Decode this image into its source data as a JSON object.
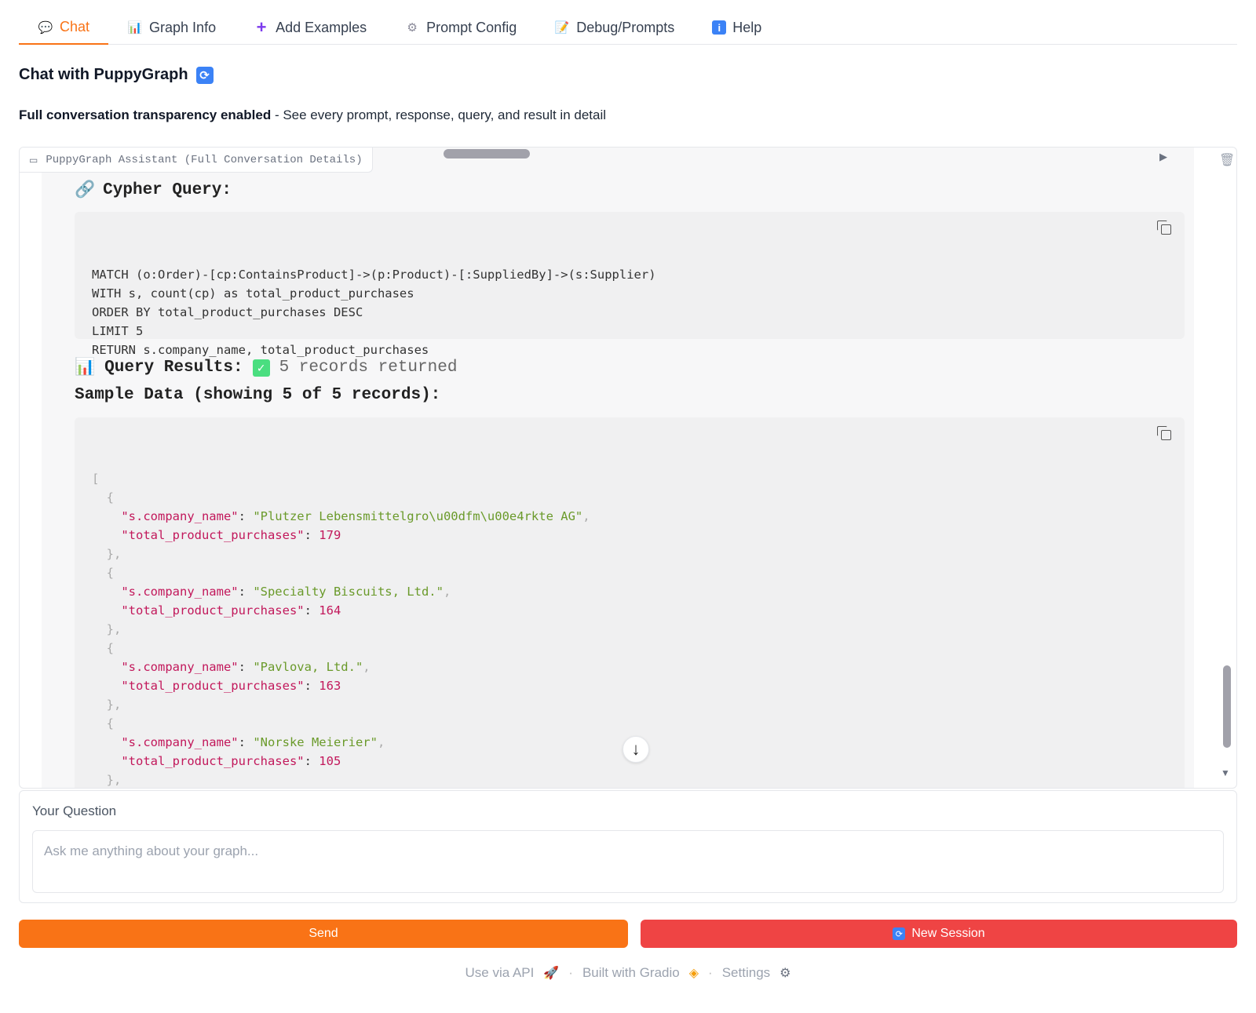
{
  "tabs": [
    {
      "label": "Chat",
      "icon": "speech-bubble-icon"
    },
    {
      "label": "Graph Info",
      "icon": "bar-chart-icon"
    },
    {
      "label": "Add Examples",
      "icon": "plus-icon"
    },
    {
      "label": "Prompt Config",
      "icon": "gear-icon"
    },
    {
      "label": "Debug/Prompts",
      "icon": "memo-icon"
    },
    {
      "label": "Help",
      "icon": "info-icon"
    }
  ],
  "header": {
    "title": "Chat with PuppyGraph",
    "subtitle_bold": "Full conversation transparency enabled",
    "subtitle_rest": " - See every prompt, response, query, and result in detail"
  },
  "chat": {
    "label": "PuppyGraph Assistant (Full Conversation Details)",
    "cypher_heading": "Cypher Query:",
    "cypher_lines": [
      "MATCH (o:Order)-[cp:ContainsProduct]->(p:Product)-[:SuppliedBy]->(s:Supplier)",
      "WITH s, count(cp) as total_product_purchases",
      "ORDER BY total_product_purchases DESC",
      "LIMIT 5",
      "RETURN s.company_name, total_product_purchases"
    ],
    "results_heading": "Query Results:",
    "records_text": "5 records returned",
    "sample_heading": "Sample Data (showing 5 of 5 records):",
    "json_key_name": "\"s.company_name\"",
    "json_key_total": "\"total_product_purchases\"",
    "records": [
      {
        "company": "\"Plutzer Lebensmittelgro\\u00dfm\\u00e4rkte AG\"",
        "total": "179"
      },
      {
        "company": "\"Specialty Biscuits, Ltd.\"",
        "total": "164"
      },
      {
        "company": "\"Pavlova, Ltd.\"",
        "total": "163"
      },
      {
        "company": "\"Norske Meierier\"",
        "total": "105"
      }
    ]
  },
  "question": {
    "label": "Your Question",
    "placeholder": "Ask me anything about your graph...",
    "value": ""
  },
  "buttons": {
    "send": "Send",
    "new_session": "New Session"
  },
  "footer": {
    "api": "Use via API",
    "gradio": "Built with Gradio",
    "settings": "Settings"
  },
  "colors": {
    "accent": "#f97316",
    "danger": "#ef4444",
    "json_key": "#c2185b",
    "json_string": "#6a9a2a"
  }
}
